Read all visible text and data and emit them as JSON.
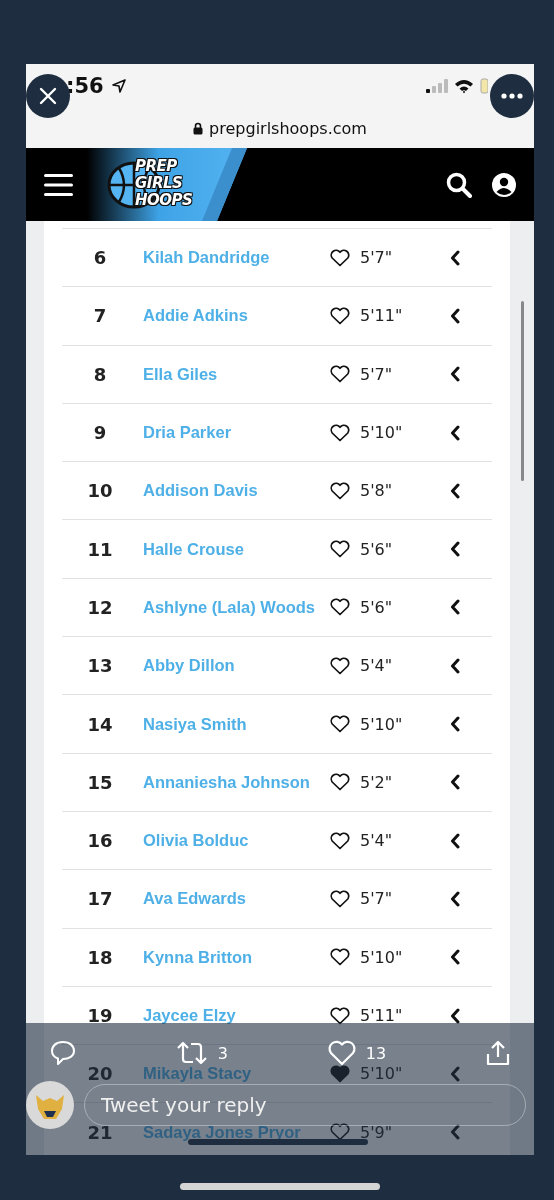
{
  "status_bar": {
    "time": ":56"
  },
  "address_bar": {
    "url": "prepgirlshoops.com"
  },
  "logo": [
    "PREP",
    "GIRLS",
    "HOOPS"
  ],
  "players": [
    {
      "rank": "6",
      "name": "Kilah Dandridge",
      "liked": false,
      "height": "5'7\""
    },
    {
      "rank": "7",
      "name": "Addie Adkins",
      "liked": false,
      "height": "5'11\""
    },
    {
      "rank": "8",
      "name": "Ella Giles",
      "liked": false,
      "height": "5'7\""
    },
    {
      "rank": "9",
      "name": "Dria Parker",
      "liked": false,
      "height": "5'10\""
    },
    {
      "rank": "10",
      "name": "Addison Davis",
      "liked": false,
      "height": "5'8\""
    },
    {
      "rank": "11",
      "name": "Halle Crouse",
      "liked": false,
      "height": "5'6\""
    },
    {
      "rank": "12",
      "name": "Ashlyne (Lala) Woods",
      "liked": false,
      "height": "5'6\""
    },
    {
      "rank": "13",
      "name": "Abby Dillon",
      "liked": false,
      "height": "5'4\""
    },
    {
      "rank": "14",
      "name": "Nasiya Smith",
      "liked": false,
      "height": "5'10\""
    },
    {
      "rank": "15",
      "name": "Annaniesha Johnson",
      "liked": false,
      "height": "5'2\""
    },
    {
      "rank": "16",
      "name": "Olivia Bolduc",
      "liked": false,
      "height": "5'4\""
    },
    {
      "rank": "17",
      "name": "Ava Edwards",
      "liked": false,
      "height": "5'7\""
    },
    {
      "rank": "18",
      "name": "Kynna Britton",
      "liked": false,
      "height": "5'10\""
    },
    {
      "rank": "19",
      "name": "Jaycee Elzy",
      "liked": false,
      "height": "5'11\""
    },
    {
      "rank": "20",
      "name": "Mikayla Stacy",
      "liked": true,
      "height": "5'10\""
    },
    {
      "rank": "21",
      "name": "Sadaya Jones Pryor",
      "liked": false,
      "height": "5'9\""
    }
  ],
  "tweet_bar": {
    "retweets": "3",
    "likes": "13",
    "reply_placeholder": "Tweet your reply"
  }
}
